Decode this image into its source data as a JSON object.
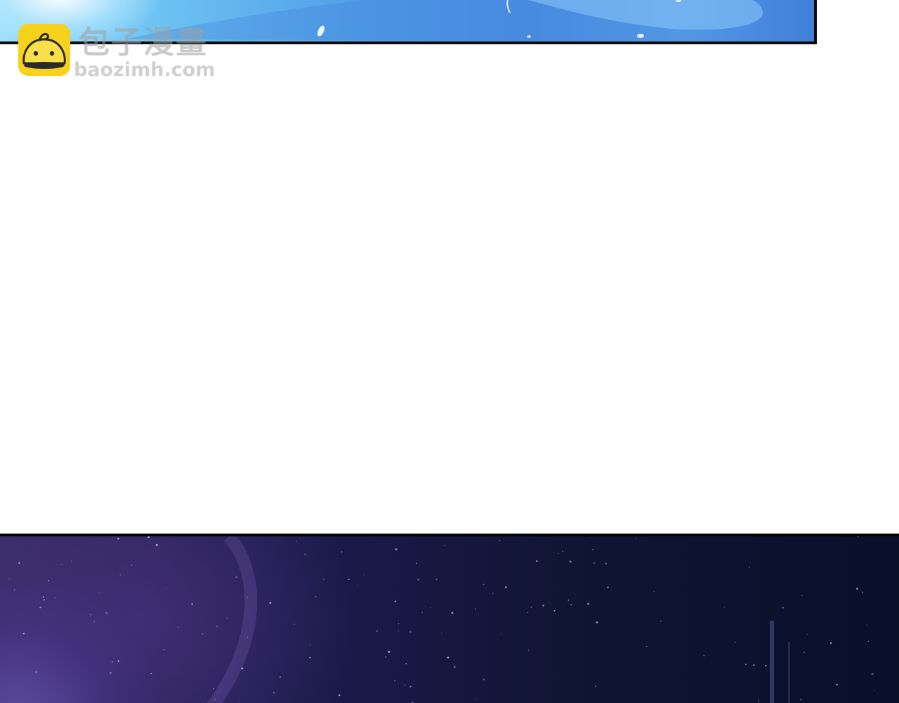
{
  "watermark": {
    "title": "包子漫畫",
    "url": "baozimh.com",
    "icon": "bun-mascot-icon",
    "badge_color": "#f7d21c"
  },
  "panels": {
    "top": {
      "colors": [
        "#9fe0fb",
        "#4f9ee6",
        "#3f7fd6"
      ]
    },
    "bottom": {
      "colors": [
        "#3a2d6a",
        "#111536",
        "#0a1028"
      ]
    }
  }
}
